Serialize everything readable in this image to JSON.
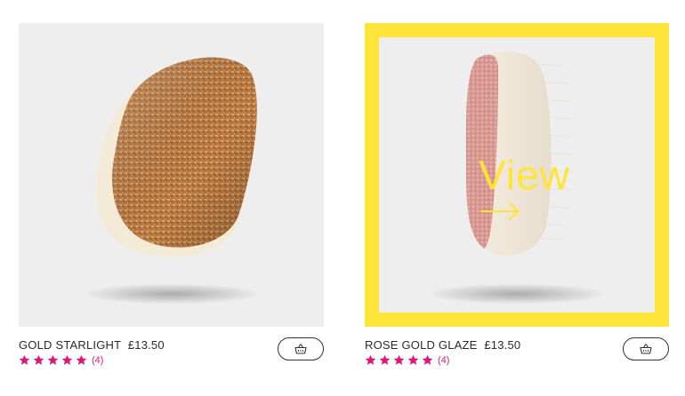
{
  "products": [
    {
      "name": "GOLD STARLIGHT",
      "price": "£13.50",
      "rating": 5,
      "review_count": "(4)",
      "icon": "basket-icon"
    },
    {
      "name": "ROSE GOLD GLAZE",
      "price": "£13.50",
      "rating": 5,
      "review_count": "(4)",
      "icon": "basket-icon",
      "hover_label": "View"
    }
  ],
  "colors": {
    "highlight": "#ffe43a",
    "star": "#d81b7b",
    "image_bg": "#eeeeee"
  }
}
